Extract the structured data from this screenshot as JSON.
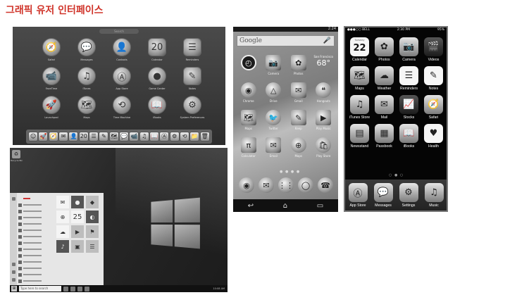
{
  "page": {
    "title": "그래픽 유저 인터페이스"
  },
  "mac": {
    "search_placeholder": "Search",
    "apps": [
      {
        "label": "Safari",
        "glyph": "🧭",
        "icon": "compass-icon"
      },
      {
        "label": "Messages",
        "glyph": "💬",
        "icon": "chat-bubble-icon"
      },
      {
        "label": "Contacts",
        "glyph": "👤",
        "icon": "contacts-book-icon"
      },
      {
        "label": "Calendar",
        "glyph": "20",
        "icon": "calendar-icon"
      },
      {
        "label": "Reminders",
        "glyph": "☰",
        "icon": "checklist-icon"
      },
      {
        "label": "FaceTime",
        "glyph": "📹",
        "icon": "video-camera-icon"
      },
      {
        "label": "iTunes",
        "glyph": "♫",
        "icon": "music-note-icon"
      },
      {
        "label": "App Store",
        "glyph": "Ⓐ",
        "icon": "app-store-icon"
      },
      {
        "label": "Game Center",
        "glyph": "●",
        "icon": "game-center-icon"
      },
      {
        "label": "Notes",
        "glyph": "✎",
        "icon": "notepad-icon"
      },
      {
        "label": "Launchpad",
        "glyph": "🚀",
        "icon": "rocket-icon"
      },
      {
        "label": "Maps",
        "glyph": "🗺",
        "icon": "map-icon"
      },
      {
        "label": "Time Machine",
        "glyph": "⟲",
        "icon": "time-machine-icon"
      },
      {
        "label": "iBooks",
        "glyph": "📖",
        "icon": "book-icon"
      },
      {
        "label": "System Preferences",
        "glyph": "⚙",
        "icon": "gear-icon"
      }
    ],
    "dock": [
      "☺",
      "🚀",
      "🧭",
      "✉",
      "👤",
      "20",
      "☰",
      "✎",
      "🗺",
      "💬",
      "📹",
      "♫",
      "📖",
      "Ⓐ",
      "⚙",
      "⟲",
      "📁",
      "🗑"
    ]
  },
  "windows": {
    "recycle_label": "Recycle Bin",
    "start_list_header": "A",
    "tiles": [
      "✉",
      "●",
      "◆",
      "⊕",
      "25",
      "◐",
      "☁",
      "▶",
      "⚑",
      "♪",
      "▣",
      "☰"
    ],
    "search_placeholder": "Type here to search",
    "tray_text": "10:08 AM"
  },
  "android": {
    "status_time": "2:24",
    "search_text": "Google",
    "mic_glyph": "🎤",
    "apps": [
      {
        "label": "",
        "glyph": "◴",
        "kind": "clock",
        "icon": "clock-icon"
      },
      {
        "label": "Camera",
        "glyph": "📷",
        "kind": "sq",
        "icon": "camera-icon"
      },
      {
        "label": "Photos",
        "glyph": "✿",
        "kind": "sq",
        "icon": "photos-icon"
      },
      {
        "label": "",
        "glyph": "",
        "kind": "weather",
        "icon": "weather-icon"
      },
      {
        "label": "Chrome",
        "glyph": "◉",
        "kind": "round",
        "icon": "chrome-icon"
      },
      {
        "label": "Drive",
        "glyph": "△",
        "kind": "round",
        "icon": "drive-icon"
      },
      {
        "label": "Gmail",
        "glyph": "✉",
        "kind": "sq",
        "icon": "mail-icon"
      },
      {
        "label": "Hangouts",
        "glyph": "❝",
        "kind": "round",
        "icon": "hangouts-icon"
      },
      {
        "label": "Maps",
        "glyph": "🗺",
        "kind": "sq",
        "icon": "map-icon"
      },
      {
        "label": "Twitter",
        "glyph": "🐦",
        "kind": "round",
        "icon": "bird-icon"
      },
      {
        "label": "Keep",
        "glyph": "✎",
        "kind": "sq",
        "icon": "keep-icon"
      },
      {
        "label": "Play Music",
        "glyph": "▶",
        "kind": "sq",
        "icon": "play-music-icon"
      },
      {
        "label": "Calculator",
        "glyph": "π",
        "kind": "sq",
        "icon": "calculator-icon"
      },
      {
        "label": "Email",
        "glyph": "✉",
        "kind": "sq",
        "icon": "email-icon"
      },
      {
        "label": "Maps",
        "glyph": "⊕",
        "kind": "round",
        "icon": "location-icon"
      },
      {
        "label": "Play Store",
        "glyph": "🛍",
        "kind": "round",
        "icon": "play-store-icon"
      }
    ],
    "weather": {
      "city": "San Francisco",
      "temp": "68°"
    },
    "dots": "● ● ● ●",
    "dock": [
      {
        "glyph": "◉",
        "icon": "chrome-icon"
      },
      {
        "glyph": "✉",
        "icon": "gmail-icon"
      },
      {
        "glyph": "⋮⋮",
        "icon": "app-drawer-icon"
      },
      {
        "glyph": "◯",
        "icon": "messaging-icon"
      },
      {
        "glyph": "☎",
        "icon": "phone-icon"
      }
    ],
    "nav": [
      {
        "glyph": "↩",
        "icon": "back-icon"
      },
      {
        "glyph": "⌂",
        "icon": "home-icon"
      },
      {
        "glyph": "▭",
        "icon": "recents-icon"
      }
    ]
  },
  "ios": {
    "carrier": "●●●○○ BELL",
    "time": "2:30 PM",
    "battery": "95%",
    "calendar_day": "Tuesday",
    "calendar_date": "22",
    "apps": [
      {
        "label": "Calendar",
        "glyph": "",
        "style": "white",
        "icon": "calendar-icon"
      },
      {
        "label": "Photos",
        "glyph": "✿",
        "style": "light",
        "icon": "photos-icon"
      },
      {
        "label": "Camera",
        "glyph": "📷",
        "style": "light",
        "icon": "camera-icon"
      },
      {
        "label": "Videos",
        "glyph": "🎬",
        "style": "dark",
        "icon": "video-clapper-icon"
      },
      {
        "label": "Maps",
        "glyph": "🗺",
        "style": "light",
        "icon": "map-icon"
      },
      {
        "label": "Weather",
        "glyph": "☁",
        "style": "light",
        "icon": "weather-icon"
      },
      {
        "label": "Reminders",
        "glyph": "☰",
        "style": "white",
        "icon": "checklist-icon"
      },
      {
        "label": "Notes",
        "glyph": "✎",
        "style": "white",
        "icon": "notepad-icon"
      },
      {
        "label": "iTunes Store",
        "glyph": "♫",
        "style": "light",
        "icon": "itunes-icon"
      },
      {
        "label": "Mail",
        "glyph": "✉",
        "style": "light",
        "icon": "mail-icon"
      },
      {
        "label": "Stocks",
        "glyph": "📈",
        "style": "dark",
        "icon": "stocks-icon"
      },
      {
        "label": "Safari",
        "glyph": "🧭",
        "style": "light",
        "icon": "compass-icon"
      },
      {
        "label": "Newsstand",
        "glyph": "▤",
        "style": "light",
        "icon": "newsstand-icon"
      },
      {
        "label": "Passbook",
        "glyph": "▦",
        "style": "light",
        "icon": "passbook-icon"
      },
      {
        "label": "iBooks",
        "glyph": "📖",
        "style": "light",
        "icon": "book-icon"
      },
      {
        "label": "Health",
        "glyph": "♥",
        "style": "white",
        "icon": "heart-icon"
      }
    ],
    "dots": "○ ● ○",
    "dock": [
      {
        "label": "App Store",
        "glyph": "Ⓐ",
        "style": "light",
        "icon": "app-store-icon"
      },
      {
        "label": "Messages",
        "glyph": "💬",
        "style": "light",
        "icon": "chat-bubble-icon"
      },
      {
        "label": "Settings",
        "glyph": "⚙",
        "style": "light",
        "icon": "gear-icon"
      },
      {
        "label": "Music",
        "glyph": "♫",
        "style": "light",
        "icon": "music-note-icon"
      }
    ]
  }
}
